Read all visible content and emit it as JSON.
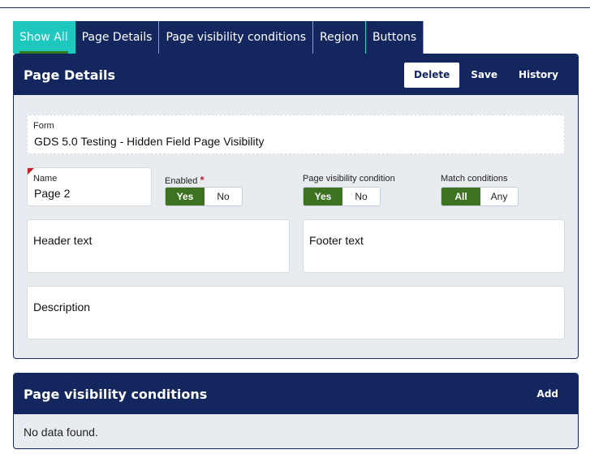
{
  "tabs": [
    {
      "label": "Show All",
      "active": true
    },
    {
      "label": "Page Details",
      "active": false
    },
    {
      "label": "Page visibility conditions",
      "active": false
    },
    {
      "label": "Region",
      "active": false
    },
    {
      "label": "Buttons",
      "active": false
    }
  ],
  "page_details": {
    "title": "Page Details",
    "buttons": {
      "delete": "Delete",
      "save": "Save",
      "history": "History"
    },
    "form": {
      "label": "Form",
      "value": "GDS 5.0 Testing - Hidden Field Page Visibility"
    },
    "name": {
      "label": "Name",
      "value": "Page 2"
    },
    "enabled": {
      "label": "Enabled",
      "required_mark": "*",
      "yes": "Yes",
      "no": "No",
      "selected": "Yes"
    },
    "page_visibility_condition": {
      "label": "Page visibility condition",
      "yes": "Yes",
      "no": "No",
      "selected": "Yes"
    },
    "match_conditions": {
      "label": "Match conditions",
      "all": "All",
      "any": "Any",
      "selected": "All"
    },
    "header_text": {
      "label": "Header text"
    },
    "footer_text": {
      "label": "Footer text"
    },
    "description": {
      "label": "Description"
    }
  },
  "visibility_conditions": {
    "title": "Page visibility conditions",
    "add_label": "Add",
    "empty_text": "No data found."
  },
  "colors": {
    "header_navy": "#13275e",
    "active_tab_teal": "#1ec8bf",
    "toggle_green": "#3c7220",
    "required_red": "#c0232c"
  }
}
